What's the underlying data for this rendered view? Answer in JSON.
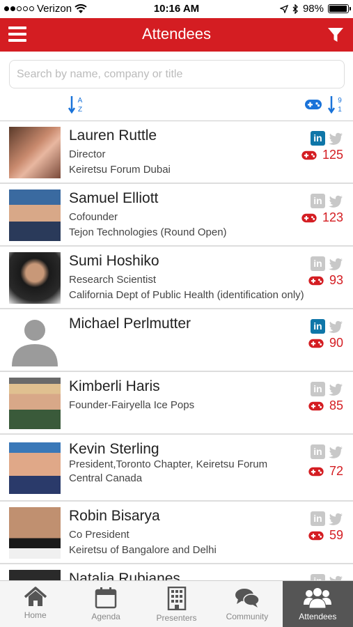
{
  "status_bar": {
    "carrier": "Verizon",
    "time": "10:16 AM",
    "battery": "98%",
    "battery_level": 0.98
  },
  "header": {
    "title": "Attendees"
  },
  "search": {
    "placeholder": "Search by name, company or title"
  },
  "sort": {
    "az_letters": [
      "A",
      "Z"
    ],
    "num_digits": [
      "9",
      "1"
    ]
  },
  "attendees": [
    {
      "name": "Lauren Ruttle",
      "title": "Director",
      "company": "Keiretsu Forum Dubai",
      "linkedin": true,
      "score": "125",
      "photo": "photo"
    },
    {
      "name": "Samuel Elliott",
      "title": "Cofounder",
      "company": "Tejon Technologies (Round Open)",
      "linkedin": false,
      "score": "123",
      "photo": "photo"
    },
    {
      "name": "Sumi Hoshiko",
      "title": "Research Scientist",
      "company": "California Dept of Public Health (identification only)",
      "linkedin": false,
      "score": "93",
      "photo": "photo"
    },
    {
      "name": "Michael Perlmutter",
      "title": "",
      "company": "",
      "linkedin": true,
      "score": "90",
      "photo": "placeholder"
    },
    {
      "name": "Kimberli Haris",
      "title": "Founder-Fairyella Ice Pops",
      "company": "",
      "linkedin": false,
      "score": "85",
      "photo": "photo"
    },
    {
      "name": "Kevin Sterling",
      "title": "President,Toronto Chapter, Keiretsu Forum",
      "company": "Central Canada",
      "linkedin": false,
      "score": "72",
      "photo": "photo"
    },
    {
      "name": "Robin Bisarya",
      "title": "Co President",
      "company": "Keiretsu of Bangalore and Delhi",
      "linkedin": false,
      "score": "59",
      "photo": "photo"
    },
    {
      "name": "Natalia Rubianes",
      "title": "",
      "company": "",
      "linkedin": false,
      "score": "",
      "photo": "photo"
    }
  ],
  "tabs": [
    {
      "label": "Home",
      "icon": "home-icon",
      "active": false
    },
    {
      "label": "Agenda",
      "icon": "calendar-icon",
      "active": false
    },
    {
      "label": "Presenters",
      "icon": "building-icon",
      "active": false
    },
    {
      "label": "Community",
      "icon": "chat-icon",
      "active": false
    },
    {
      "label": "Attendees",
      "icon": "people-icon",
      "active": true
    }
  ],
  "colors": {
    "brand_red": "#d41d22",
    "linkedin_blue": "#0e76a8",
    "sort_blue": "#1a73d9",
    "tab_active": "#555555"
  }
}
